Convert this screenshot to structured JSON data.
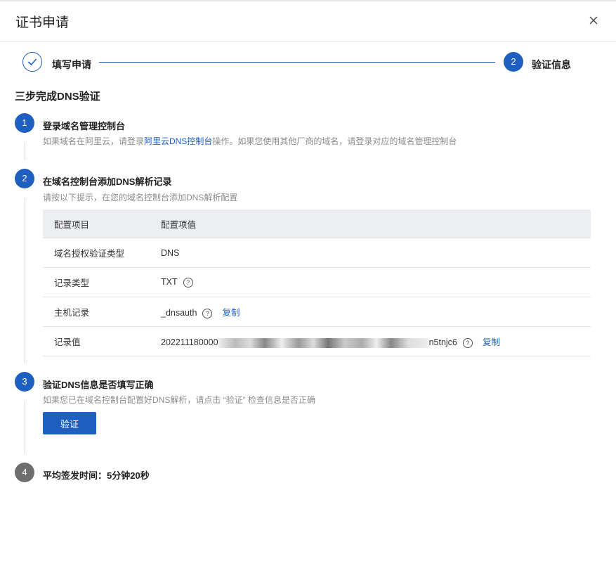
{
  "dialog": {
    "title": "证书申请"
  },
  "steps": {
    "step1_label": "填写申请",
    "step2_number": "2",
    "step2_label": "验证信息"
  },
  "section_title": "三步完成DNS验证",
  "s1": {
    "number": "1",
    "title": "登录域名管理控制台",
    "desc_before": "如果域名在阿里云，请登录",
    "link": "阿里云DNS控制台",
    "desc_after": "操作。如果您使用其他厂商的域名，请登录对应的域名管理控制台"
  },
  "s2": {
    "number": "2",
    "title": "在域名控制台添加DNS解析记录",
    "desc": "请按以下提示，在您的域名控制台添加DNS解析配置",
    "table": {
      "headers": [
        "配置项目",
        "配置项值"
      ],
      "rows": [
        {
          "label": "域名授权验证类型",
          "value": "DNS"
        },
        {
          "label": "记录类型",
          "value": "TXT"
        },
        {
          "label": "主机记录",
          "value": "_dnsauth",
          "copy": "复制"
        },
        {
          "label": "记录值",
          "value_prefix": "202211180000",
          "value_suffix": "n5tnjc6",
          "copy": "复制"
        }
      ]
    }
  },
  "s3": {
    "number": "3",
    "title": "验证DNS信息是否填写正确",
    "desc": "如果您已在域名控制台配置好DNS解析，请点击 “验证” 检查信息是否正确",
    "button": "验证"
  },
  "s4": {
    "number": "4",
    "title": "平均签发时间：5分钟20秒"
  },
  "icons": {
    "close": "close-icon",
    "done": "check-icon",
    "help": "question-circle-icon"
  },
  "colors": {
    "primary": "#1f5fbf",
    "muted": "#8c8c8c",
    "table_header": "#eceef2"
  }
}
